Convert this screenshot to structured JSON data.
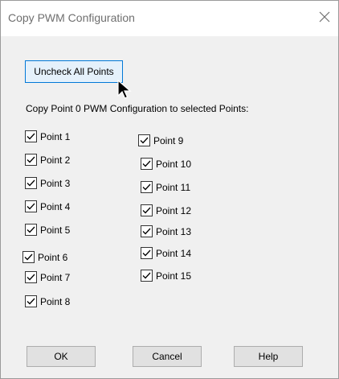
{
  "window": {
    "title": "Copy PWM Configuration",
    "close_icon": "close-icon"
  },
  "uncheck_button_label": "Uncheck All Points",
  "copy_label": "Copy Point 0 PWM Configuration to selected Points:",
  "points_left": [
    {
      "label": "Point 1",
      "checked": true
    },
    {
      "label": "Point 2",
      "checked": true
    },
    {
      "label": "Point 3",
      "checked": true
    },
    {
      "label": "Point 4",
      "checked": true
    },
    {
      "label": "Point 5",
      "checked": true
    },
    {
      "label": "Point 6",
      "checked": true
    },
    {
      "label": "Point 7",
      "checked": true
    },
    {
      "label": "Point 8",
      "checked": true
    }
  ],
  "points_right": [
    {
      "label": "Point 9",
      "checked": true
    },
    {
      "label": "Point 10",
      "checked": true
    },
    {
      "label": "Point 11",
      "checked": true
    },
    {
      "label": "Point 12",
      "checked": true
    },
    {
      "label": "Point 13",
      "checked": true
    },
    {
      "label": "Point 14",
      "checked": true
    },
    {
      "label": "Point 15",
      "checked": true
    }
  ],
  "buttons": {
    "ok": "OK",
    "cancel": "Cancel",
    "help": "Help"
  },
  "colors": {
    "focus_border": "#0078d7",
    "focus_fill": "#e5f1fb"
  }
}
